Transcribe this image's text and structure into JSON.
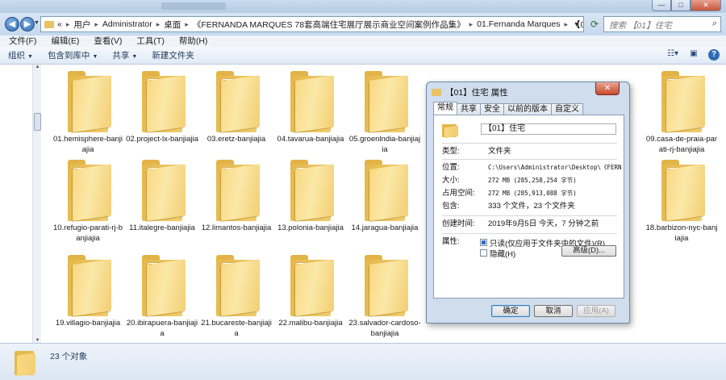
{
  "window": {
    "controls": {
      "minimize": "—",
      "maximize": "□",
      "close": "✕"
    }
  },
  "address": {
    "segments": [
      "用户",
      "Administrator",
      "桌面",
      "《FERNANDA MARQUES 78套高端住宅展厅展示商业空间案例作品集》",
      "01.Fernanda Marques",
      "【01】住宅"
    ],
    "prefix": "«",
    "search_placeholder": "搜索 【01】住宅"
  },
  "menu": [
    "文件(F)",
    "编辑(E)",
    "查看(V)",
    "工具(T)",
    "帮助(H)"
  ],
  "toolbar": {
    "organize": "组织",
    "include": "包含到库中",
    "share": "共享",
    "new_folder": "新建文件夹"
  },
  "files": [
    {
      "name": "01.hemisphere-banjiajia",
      "photo": ""
    },
    {
      "name": "02.project-lx-banjiajia",
      "photo": "#b8aa98"
    },
    {
      "name": "03.eretz-banjiajia",
      "photo": "#8e7a66"
    },
    {
      "name": "04.tavarua-banjiajia",
      "photo": ""
    },
    {
      "name": "05.groenlndia-banjiajia",
      "photo": ""
    },
    {
      "name": "09.casa-de-praia-parati-rj-banjiajia",
      "photo": "#a8907a"
    },
    {
      "name": "10.refugio-parati-rj-banjiajia",
      "photo": "#6e6c68"
    },
    {
      "name": "11.italegre-banjiajia",
      "photo": "#8c8276"
    },
    {
      "name": "12.limantos-banjiajia",
      "photo": "#5d6a4c"
    },
    {
      "name": "13.polonia-banjiajia",
      "photo": "#c2aea0"
    },
    {
      "name": "14.jaragua-banjiajia",
      "photo": ""
    },
    {
      "name": "18.barbizon-nyc-banjiajia",
      "photo": "#9c8c80"
    },
    {
      "name": "19.villagio-banjiajia",
      "photo": ""
    },
    {
      "name": "20.ibirapuera-banjiajia",
      "photo": "#8a6f5e"
    },
    {
      "name": "21.bucareste-banjiajia",
      "photo": "#a4b0b4"
    },
    {
      "name": "22.malibu-banjiajia",
      "photo": "#a89a82"
    },
    {
      "name": "23.salvador-cardoso-banjiajia",
      "photo": ""
    }
  ],
  "status": {
    "count_text": "23 个对象"
  },
  "dialog": {
    "title": "【01】住宅 属性",
    "close": "✕",
    "tabs": [
      "常规",
      "共享",
      "安全",
      "以前的版本",
      "自定义"
    ],
    "name": "【01】住宅",
    "type_label": "类型:",
    "type": "文件夹",
    "location_label": "位置:",
    "location": "C:\\Users\\Administrator\\Desktop\\《FERNANDA",
    "size_label": "大小:",
    "size": "272 MB (285,258,254 字节)",
    "size_on_disk_label": "占用空间:",
    "size_on_disk": "272 MB (285,913,088 字节)",
    "contains_label": "包含:",
    "contains": "333 个文件，23 个文件夹",
    "created_label": "创建时间:",
    "created": "2019年9月5日 今天，7 分钟之前",
    "attributes_label": "属性:",
    "readonly": "只读(仅应用于文件夹中的文件)(R)",
    "hidden": "隐藏(H)",
    "advanced": "高级(D)...",
    "ok": "确定",
    "cancel": "取消",
    "apply": "应用(A)"
  }
}
